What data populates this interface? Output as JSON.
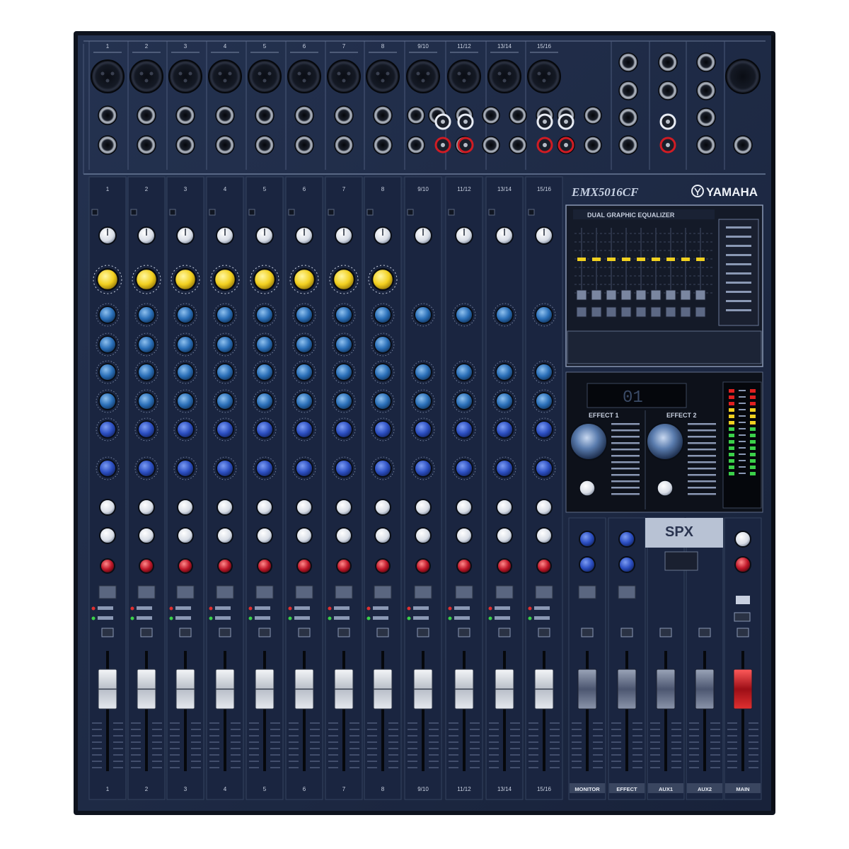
{
  "mixer": {
    "brand": "YAMAHA",
    "model": "EMX5016CF"
  },
  "top_channel_labels": [
    "1",
    "2",
    "3",
    "4",
    "5",
    "6",
    "7",
    "8",
    "9/10",
    "11/12",
    "13/14",
    "15/16"
  ],
  "strip_channel_labels": [
    "1",
    "2",
    "3",
    "4",
    "5",
    "6",
    "7",
    "8",
    "9/10",
    "11/12",
    "13/14",
    "15/16"
  ],
  "bottom_channel_labels": [
    "1",
    "2",
    "3",
    "4",
    "5",
    "6",
    "7",
    "8",
    "9/10",
    "11/12",
    "13/14",
    "15/16"
  ],
  "master_labels": [
    "MONITOR",
    "EFFECT",
    "AUX1",
    "AUX2",
    "MAIN"
  ],
  "graphic_eq": {
    "title": "DUAL GRAPHIC EQUALIZER"
  },
  "effects": {
    "unit_labels": [
      "EFFECT 1",
      "EFFECT 2"
    ],
    "display_value": "01"
  },
  "spx_badge": "SPX",
  "colors": {
    "panel": "#1d2942",
    "gain_knob": "#e8ecf2",
    "yellow_knob": "#f2d020",
    "blue_knob": "#2a6fb8",
    "red_knob": "#c0182a",
    "main_fader": "#d01c24",
    "meter_green": "#3bd04a",
    "meter_yellow": "#f0d020",
    "meter_red": "#e02020"
  }
}
